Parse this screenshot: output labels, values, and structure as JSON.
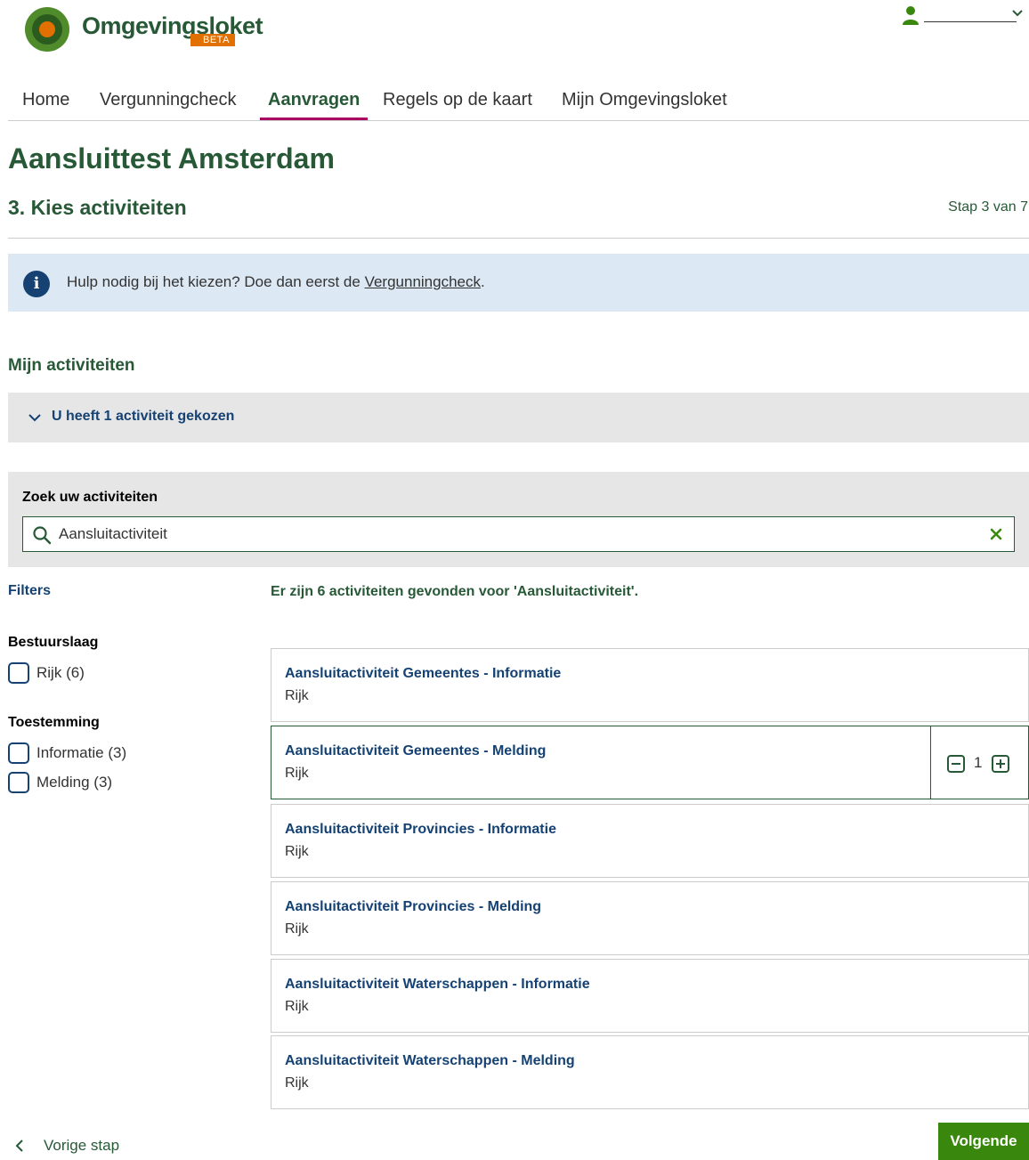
{
  "header": {
    "logo_text": "Omgevingsloket",
    "logo_badge": "BETA",
    "user_icon": "user-icon",
    "user_menu_icon": "chevron-down-icon"
  },
  "nav": {
    "items": [
      {
        "label": "Home",
        "active": false
      },
      {
        "label": "Vergunningcheck",
        "active": false
      },
      {
        "label": "Aanvragen",
        "active": true
      },
      {
        "label": "Regels op de kaart",
        "active": false
      },
      {
        "label": "Mijn Omgevingsloket",
        "active": false
      }
    ]
  },
  "page": {
    "title": "Aansluittest Amsterdam",
    "step_title": "3. Kies activiteiten",
    "step_count": "Stap 3 van 7"
  },
  "info": {
    "icon": "info-icon",
    "text_before": "Hulp nodig bij het kiezen? Doe dan eerst de ",
    "link_text": "Vergunningcheck",
    "text_after": "."
  },
  "my_activities": {
    "title": "Mijn activiteiten",
    "summary": "U heeft 1 activiteit gekozen"
  },
  "search": {
    "label": "Zoek uw activiteiten",
    "value": "Aansluitactiviteit",
    "search_icon": "search-icon",
    "clear_icon": "close-icon"
  },
  "filters": {
    "label": "Filters",
    "groups": [
      {
        "title": "Bestuurslaag",
        "options": [
          {
            "name": "Rijk",
            "count": "(6)",
            "checked": false
          }
        ]
      },
      {
        "title": "Toestemming",
        "options": [
          {
            "name": "Informatie",
            "count": "(3)",
            "checked": false
          },
          {
            "name": "Melding",
            "count": "(3)",
            "checked": false
          }
        ]
      }
    ]
  },
  "results": {
    "summary": "Er zijn 6 activiteiten gevonden voor 'Aansluitactiviteit'.",
    "items": [
      {
        "name": "Aansluitactiviteit Gemeentes - Informatie",
        "layer": "Rijk",
        "selected": false
      },
      {
        "name": "Aansluitactiviteit Gemeentes - Melding",
        "layer": "Rijk",
        "selected": true,
        "quantity": "1"
      },
      {
        "name": "Aansluitactiviteit Provincies - Informatie",
        "layer": "Rijk",
        "selected": false
      },
      {
        "name": "Aansluitactiviteit Provincies - Melding",
        "layer": "Rijk",
        "selected": false
      },
      {
        "name": "Aansluitactiviteit Waterschappen - Informatie",
        "layer": "Rijk",
        "selected": false
      },
      {
        "name": "Aansluitactiviteit Waterschappen - Melding",
        "layer": "Rijk",
        "selected": false
      }
    ]
  },
  "footer": {
    "back_label": "Vorige stap",
    "next_label": "Volgende"
  },
  "colors": {
    "brand_green": "#275937",
    "button_green": "#39870c",
    "nav_active_underline": "#a90061",
    "text_blue": "#154273",
    "info_background": "#dce8f3",
    "panel_grey": "#e6e6e6",
    "logo_orange": "#e17000"
  }
}
